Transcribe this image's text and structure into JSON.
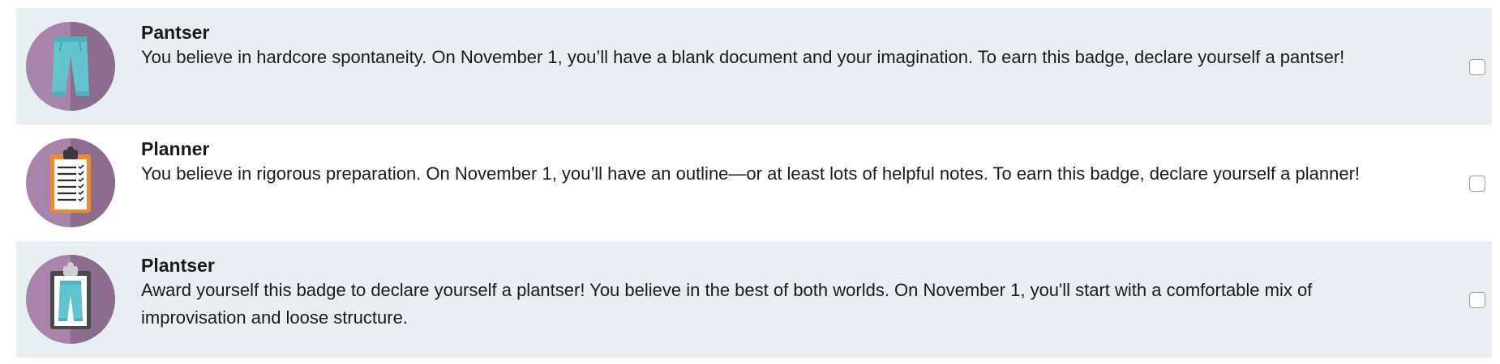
{
  "badges": [
    {
      "title": "Pantser",
      "description": "You believe in hardcore spontaneity. On November 1, you’ll have a blank document and your imagination. To earn this badge, declare yourself a pantser!",
      "icon": "pants-icon",
      "checked": false
    },
    {
      "title": "Planner",
      "description": "You believe in rigorous preparation. On November 1, you’ll have an outline—or at least lots of helpful notes. To earn this badge, declare yourself a planner!",
      "icon": "clipboard-checklist-icon",
      "checked": false
    },
    {
      "title": "Plantser",
      "description": "Award yourself this badge to declare yourself a plantser! You believe in the best of both worlds. On November 1, you'll start with a comfortable mix of improvisation and loose structure.",
      "icon": "clipboard-pants-icon",
      "checked": false
    }
  ],
  "colors": {
    "row_shaded": "#e8eff3",
    "circle_light": "#a884aa",
    "circle_dark": "#8c6d8e",
    "pants": "#62c4cf",
    "clipboard_frame": "#ef8a2c",
    "clipboard_dark": "#4a4a4a"
  }
}
